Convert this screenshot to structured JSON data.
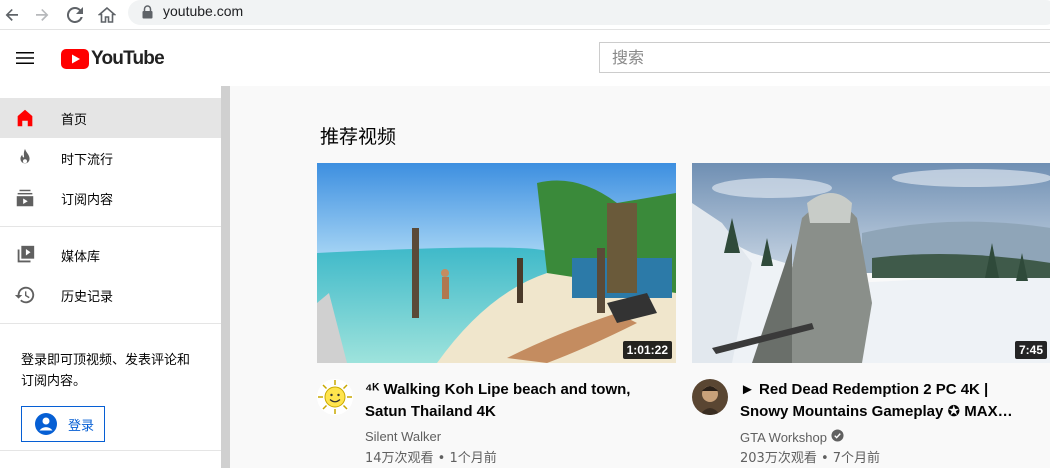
{
  "browser": {
    "url": "youtube.com",
    "icons": [
      "back-icon",
      "forward-icon",
      "reload-icon",
      "home-icon",
      "lock-icon"
    ]
  },
  "masthead": {
    "logo_text": "YouTube",
    "search_placeholder": "搜索"
  },
  "sidebar": {
    "items": [
      {
        "label": "首页",
        "icon": "home-icon",
        "active": true
      },
      {
        "label": "时下流行",
        "icon": "trending-icon"
      },
      {
        "label": "订阅内容",
        "icon": "subscriptions-icon"
      },
      {
        "label": "媒体库",
        "icon": "library-icon"
      },
      {
        "label": "历史记录",
        "icon": "history-icon"
      }
    ],
    "signin_prompt": "登录即可顶视频、发表评论和订阅内容。",
    "signin_button": "登录"
  },
  "main": {
    "section_title": "推荐视频",
    "videos": [
      {
        "title": "⁴ᴷ Walking Koh Lipe beach and town, Satun Thailand 4K",
        "duration": "1:01:22",
        "channel": "Silent Walker",
        "stats": "14万次观看 • 1个月前",
        "verified": false
      },
      {
        "title": "► Red Dead Redemption 2 PC 4K | Snowy Mountains Gameplay ✪ MAX…",
        "duration": "7:45",
        "channel": "GTA Workshop",
        "stats": "203万次观看 • 7个月前",
        "verified": true
      }
    ]
  },
  "colors": {
    "brand_red": "#ff0000",
    "link_blue": "#065fd4",
    "active_bg": "#e5e5e5"
  }
}
